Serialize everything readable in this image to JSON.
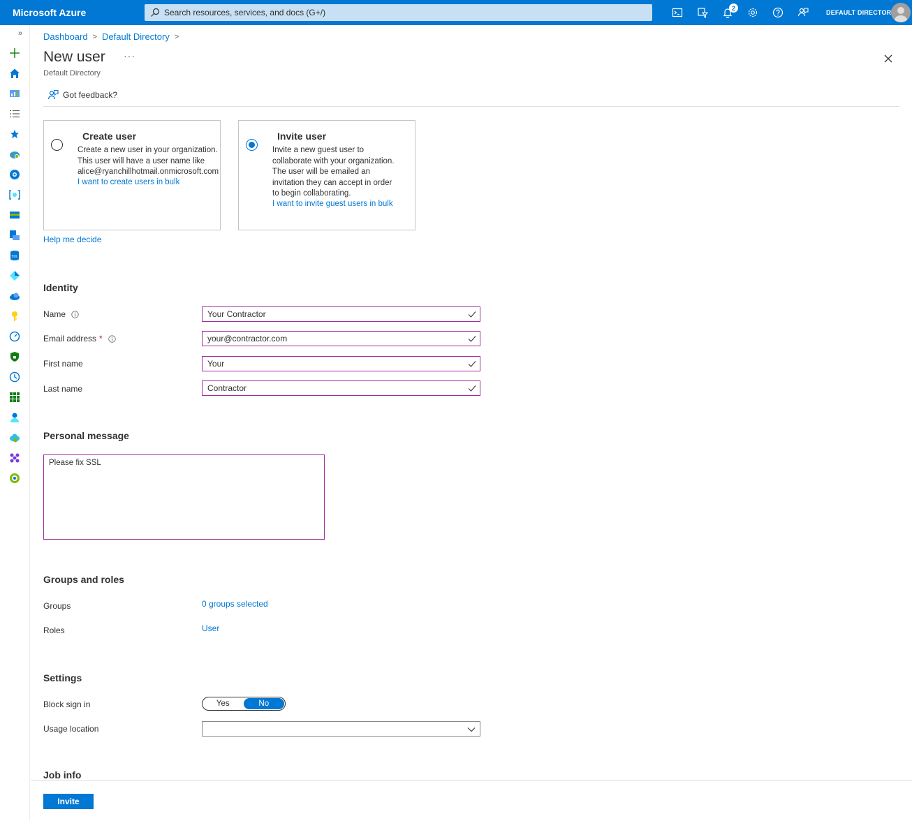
{
  "app": {
    "brand": "Microsoft Azure",
    "search_placeholder": "Search resources, services, and docs (G+/)",
    "notification_count": "2",
    "directory_label": "DEFAULT DIRECTORY"
  },
  "breadcrumb": [
    "Dashboard",
    "Default Directory"
  ],
  "page": {
    "title": "New user",
    "more": "···",
    "subtitle": "Default Directory",
    "feedback": "Got feedback?"
  },
  "options": {
    "create": {
      "title": "Create user",
      "lines": [
        "Create a new user in your organization.",
        "This user will have a user name like",
        "alice@ryanchillhotmail.onmicrosoft.com"
      ],
      "link": "I want to create users in bulk",
      "selected": false
    },
    "invite": {
      "title": "Invite user",
      "lines": [
        "Invite a new guest user to",
        "collaborate with your organization.",
        "The user will be emailed an",
        "invitation they can accept in order",
        "to begin collaborating."
      ],
      "link": "I want to invite guest users in bulk",
      "selected": true
    },
    "help": "Help me decide"
  },
  "identity": {
    "heading": "Identity",
    "name_label": "Name",
    "name_value": "Your Contractor",
    "email_label": "Email address",
    "email_required": "*",
    "email_value": "your@contractor.com",
    "first_label": "First name",
    "first_value": "Your",
    "last_label": "Last name",
    "last_value": "Contractor"
  },
  "personal_message": {
    "heading": "Personal message",
    "value": "Please fix SSL"
  },
  "groups_roles": {
    "heading": "Groups and roles",
    "groups_label": "Groups",
    "groups_value": "0 groups selected",
    "roles_label": "Roles",
    "roles_value": "User"
  },
  "settings": {
    "heading": "Settings",
    "block_label": "Block sign in",
    "yes": "Yes",
    "no": "No",
    "selected": "No",
    "usage_label": "Usage location",
    "usage_value": ""
  },
  "job_info": {
    "heading": "Job info"
  },
  "footer": {
    "invite": "Invite"
  },
  "colors": {
    "accent": "#0078d4",
    "field_border": "#9f2e9c",
    "required": "#a4262c"
  }
}
